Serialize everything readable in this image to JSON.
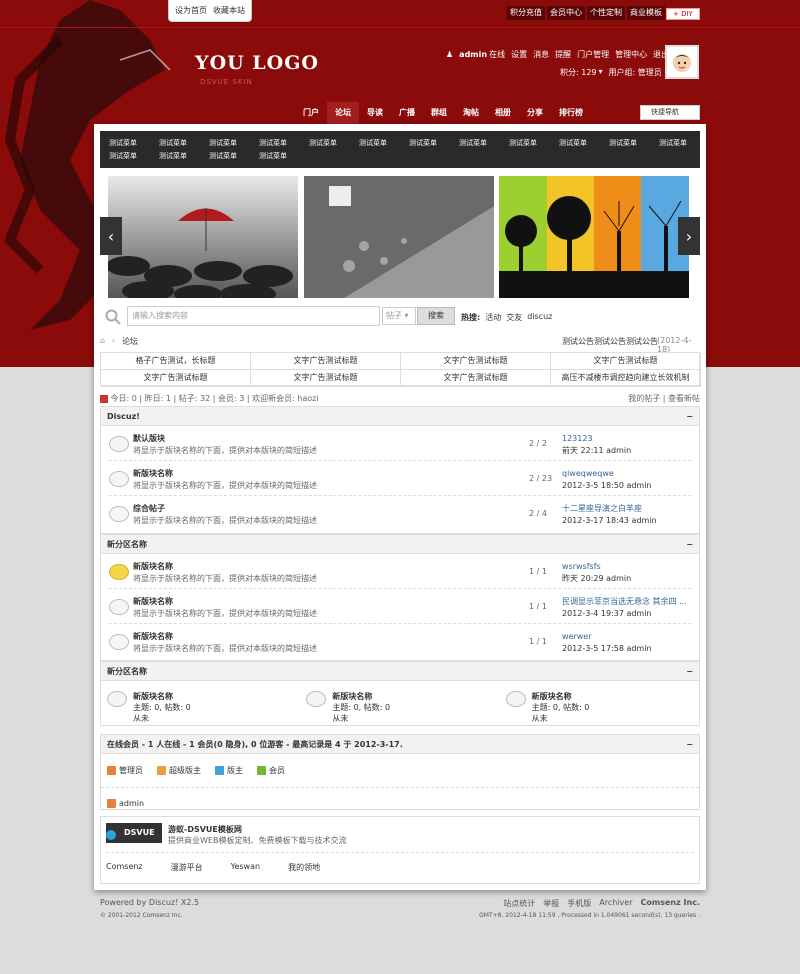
{
  "topbar": {
    "left_links": [
      "设为首页",
      "收藏本站"
    ],
    "right_links": [
      "积分充值",
      "会员中心",
      "个性定制",
      "商业模板"
    ],
    "diy": "+ DIY"
  },
  "logo": {
    "text": "YOU LOGO",
    "sub": "DSVUE SKIN"
  },
  "user": {
    "name": "admin",
    "status": "在线",
    "links": [
      "设置",
      "消息",
      "提醒",
      "门户管理",
      "管理中心",
      "退出"
    ],
    "credits": "积分: 129",
    "group": "用户组: 管理员"
  },
  "nav": {
    "items": [
      "门户",
      "论坛",
      "导读",
      "广播",
      "群组",
      "淘帖",
      "相册",
      "分享",
      "排行榜"
    ],
    "quick": "快捷导航"
  },
  "menu": {
    "items": [
      "测试菜单",
      "测试菜单",
      "测试菜单",
      "测试菜单",
      "测试菜单",
      "测试菜单",
      "测试菜单",
      "测试菜单",
      "测试菜单",
      "测试菜单",
      "测试菜单",
      "测试菜单",
      "测试菜单",
      "测试菜单",
      "测试菜单",
      "测试菜单"
    ]
  },
  "search": {
    "placeholder": "请输入搜索内容",
    "type": "帖子",
    "button": "搜索",
    "hot_label": "热搜:",
    "hot": [
      "活动",
      "交友",
      "discuz"
    ]
  },
  "breadcrumb": {
    "current": "论坛",
    "notice": "测试公告测试公告测试公告",
    "notice_date": "(2012-4-18)"
  },
  "ads": [
    "格子广告测试，长标题",
    "文字广告测试标题",
    "文字广告测试标题",
    "文字广告测试标题",
    "文字广告测试标题",
    "文字广告测试标题",
    "文字广告测试标题",
    "高压不减楼市调控趋向建立长效机制"
  ],
  "stats": {
    "text": "今日: 0 | 昨日: 1 | 帖子: 32 | 会员: 3 | 欢迎新会员: haozi",
    "my_posts": "我的帖子",
    "new_posts": "查看新帖"
  },
  "categories": [
    {
      "name": "Discuz!",
      "forums": [
        {
          "title": "默认版块",
          "desc": "将显示于版块名称的下面，提供对本版块的简短描述",
          "count": "2 / 2",
          "last1": "123123",
          "last2": "前天 22:11 admin",
          "new": false
        },
        {
          "title": "新版块名称",
          "desc": "将显示于版块名称的下面，提供对本版块的简短描述",
          "count": "2 / 23",
          "last1": "qiweqweqwe",
          "last2": "2012-3-5 18:50 admin",
          "new": false
        },
        {
          "title": "综合帖子",
          "desc": "将显示于版块名称的下面，提供对本版块的简短描述",
          "count": "2 / 4",
          "last1": "十二星座导演之白羊座",
          "last2": "2012-3-17 18:43 admin",
          "new": false
        }
      ]
    },
    {
      "name": "新分区名称",
      "forums": [
        {
          "title": "新版块名称",
          "desc": "将显示于版块名称的下面，提供对本版块的简短描述",
          "count": "1 / 1",
          "last1": "wsrwsfsfs",
          "last2": "昨天 20:29 admin",
          "new": true
        },
        {
          "title": "新版块名称",
          "desc": "将显示于版块名称的下面，提供对本版块的简短描述",
          "count": "1 / 1",
          "last1": "民调显示菲京当选无悬念 其余四 ...",
          "last2": "2012-3-4 19:37 admin",
          "new": false
        },
        {
          "title": "新版块名称",
          "desc": "将显示于版块名称的下面，提供对本版块的简短描述",
          "count": "1 / 1",
          "last1": "werwer",
          "last2": "2012-3-5 17:58 admin",
          "new": false
        }
      ]
    }
  ],
  "category3": {
    "name": "新分区名称",
    "cells": [
      {
        "title": "新版块名称",
        "desc": "主题: 0, 帖数: 0",
        "last": "从未"
      },
      {
        "title": "新版块名称",
        "desc": "主题: 0, 帖数: 0",
        "last": "从未"
      },
      {
        "title": "新版块名称",
        "desc": "主题: 0, 帖数: 0",
        "last": "从未"
      }
    ]
  },
  "online": {
    "title": "在线会员 - 1 人在线 - 1 会员(0 隐身), 0 位游客 - 最高记录是 4 于 2012-3-17.",
    "legend": [
      {
        "label": "管理员",
        "color": "#e8803a"
      },
      {
        "label": "超级版主",
        "color": "#e8a040"
      },
      {
        "label": "版主",
        "color": "#40a0d8"
      },
      {
        "label": "会员",
        "color": "#70b830"
      }
    ],
    "users": [
      "admin"
    ]
  },
  "links": {
    "logo": "DSVUE",
    "title": "游蚁-DSVUE模板网",
    "desc": "提供商业WEB模板定制、免费模板下载与技术交流",
    "items": [
      "Comsenz",
      "漫游平台",
      "Yeswan",
      "我的领地"
    ]
  },
  "footer": {
    "powered": "Powered by Discuz! X2.5",
    "copyright": "© 2001-2012 Comsenz Inc.",
    "links": [
      "站点统计",
      "举报",
      "手机版",
      "Archiver",
      "Comsenz Inc."
    ],
    "gmt": "GMT+8, 2012-4-18 11:59 , Processed in 1.049061 second(s), 13 queries ."
  }
}
